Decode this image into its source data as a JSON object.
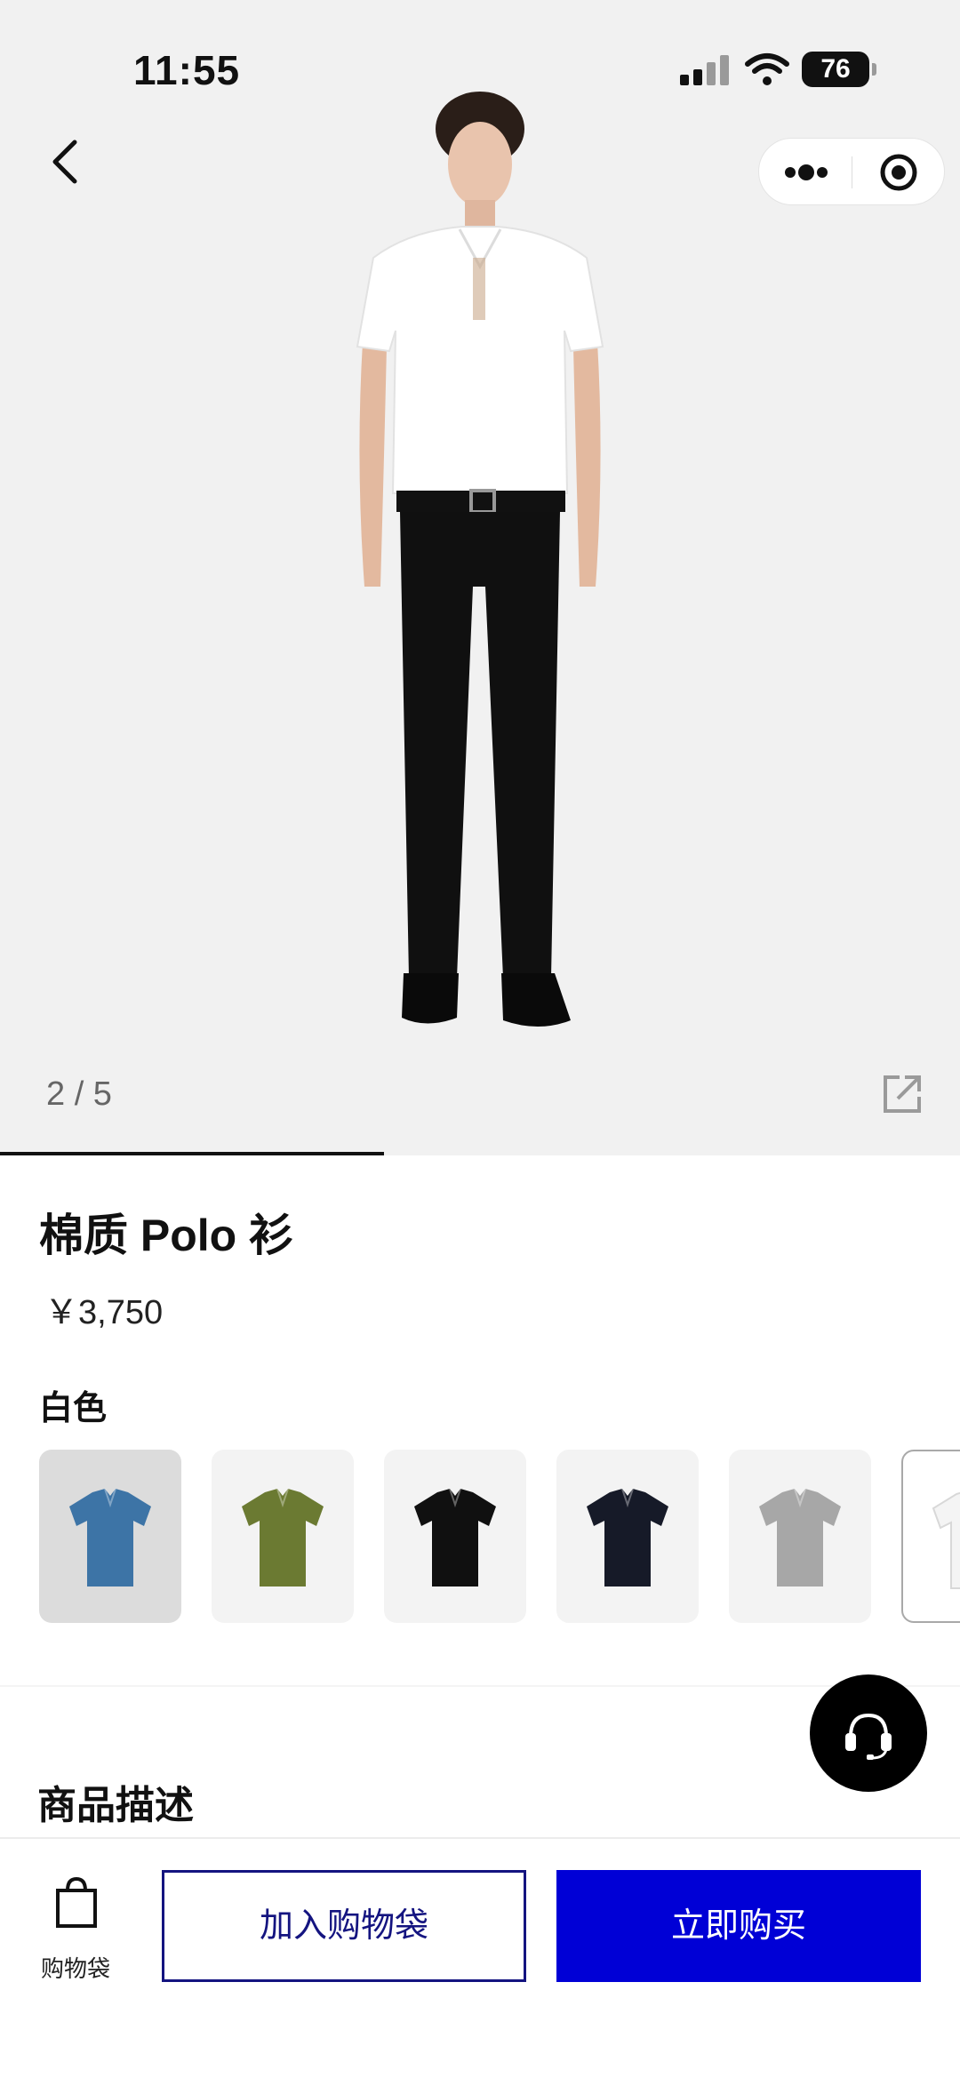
{
  "status_bar": {
    "time": "11:55",
    "battery": "76"
  },
  "gallery": {
    "counter": "2 / 5",
    "current": 2,
    "total": 5,
    "progress_fraction": 0.4
  },
  "product": {
    "title": "棉质 Polo 衫",
    "price": "￥3,750",
    "selected_color_name": "白色"
  },
  "swatches": [
    {
      "name": "blue",
      "shirt_color": "#3d74a6",
      "selected": true
    },
    {
      "name": "olive",
      "shirt_color": "#6b7a32",
      "selected": false
    },
    {
      "name": "black",
      "shirt_color": "#101010",
      "selected": false
    },
    {
      "name": "navy",
      "shirt_color": "#161a28",
      "selected": false
    },
    {
      "name": "grey",
      "shirt_color": "#a7a7a7",
      "selected": false
    },
    {
      "name": "white",
      "shirt_color": "#f4f4f4",
      "selected": false
    }
  ],
  "sections": {
    "description_heading": "商品描述"
  },
  "bottom_bar": {
    "bag_label": "购物袋",
    "add_to_bag": "加入购物袋",
    "buy_now": "立即购买"
  },
  "colors": {
    "accent": "#0000d6",
    "add_button_text": "#141480",
    "hero_background": "#f1f1f1"
  },
  "icons": [
    "back-icon",
    "more-dots-icon",
    "target-icon",
    "share-icon",
    "headset-icon",
    "shopping-bag-icon"
  ]
}
